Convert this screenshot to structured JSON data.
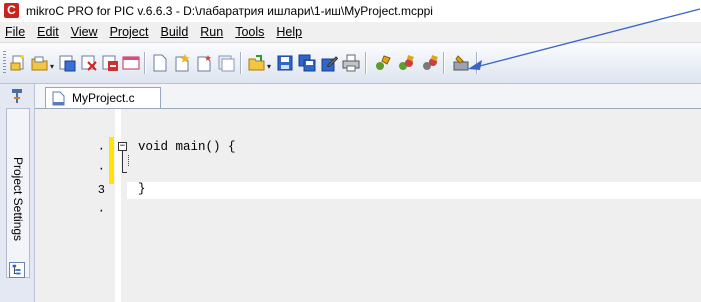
{
  "window": {
    "logo_letter": "C",
    "title": "mikroC PRO for PIC v.6.6.3 - D:\\лабаратрия ишлари\\1-иш\\MyProject.mcppi"
  },
  "menu": [
    {
      "label": "File"
    },
    {
      "label": "Edit"
    },
    {
      "label": "View"
    },
    {
      "label": "Project"
    },
    {
      "label": "Build"
    },
    {
      "label": "Run"
    },
    {
      "label": "Tools"
    },
    {
      "label": "Help"
    }
  ],
  "toolbar": {
    "icons": [
      "new-project-icon",
      "open-project-icon",
      "save-project-icon",
      "close-project-icon",
      "remove-icon",
      "project-window-icon",
      "new-file-icon",
      "add-file-icon",
      "new-unit-icon",
      "project-files-icon",
      "open-file-icon",
      "save-icon",
      "save-all-icon",
      "save-as-icon",
      "print-icon",
      "build-icon",
      "build-all-icon",
      "build-program-icon",
      "programmer-icon"
    ]
  },
  "dock": {
    "project_settings_label": "Project Settings"
  },
  "editor": {
    "tab_label": "MyProject.c",
    "line_markers": [
      "·",
      "·",
      "3",
      "·"
    ],
    "code_lines": [
      "void main() {",
      "",
      "}"
    ]
  },
  "colors": {
    "logo": "#c8231d",
    "modified_bar": "#ffe600",
    "annotation_arrow": "#3a64c8"
  }
}
